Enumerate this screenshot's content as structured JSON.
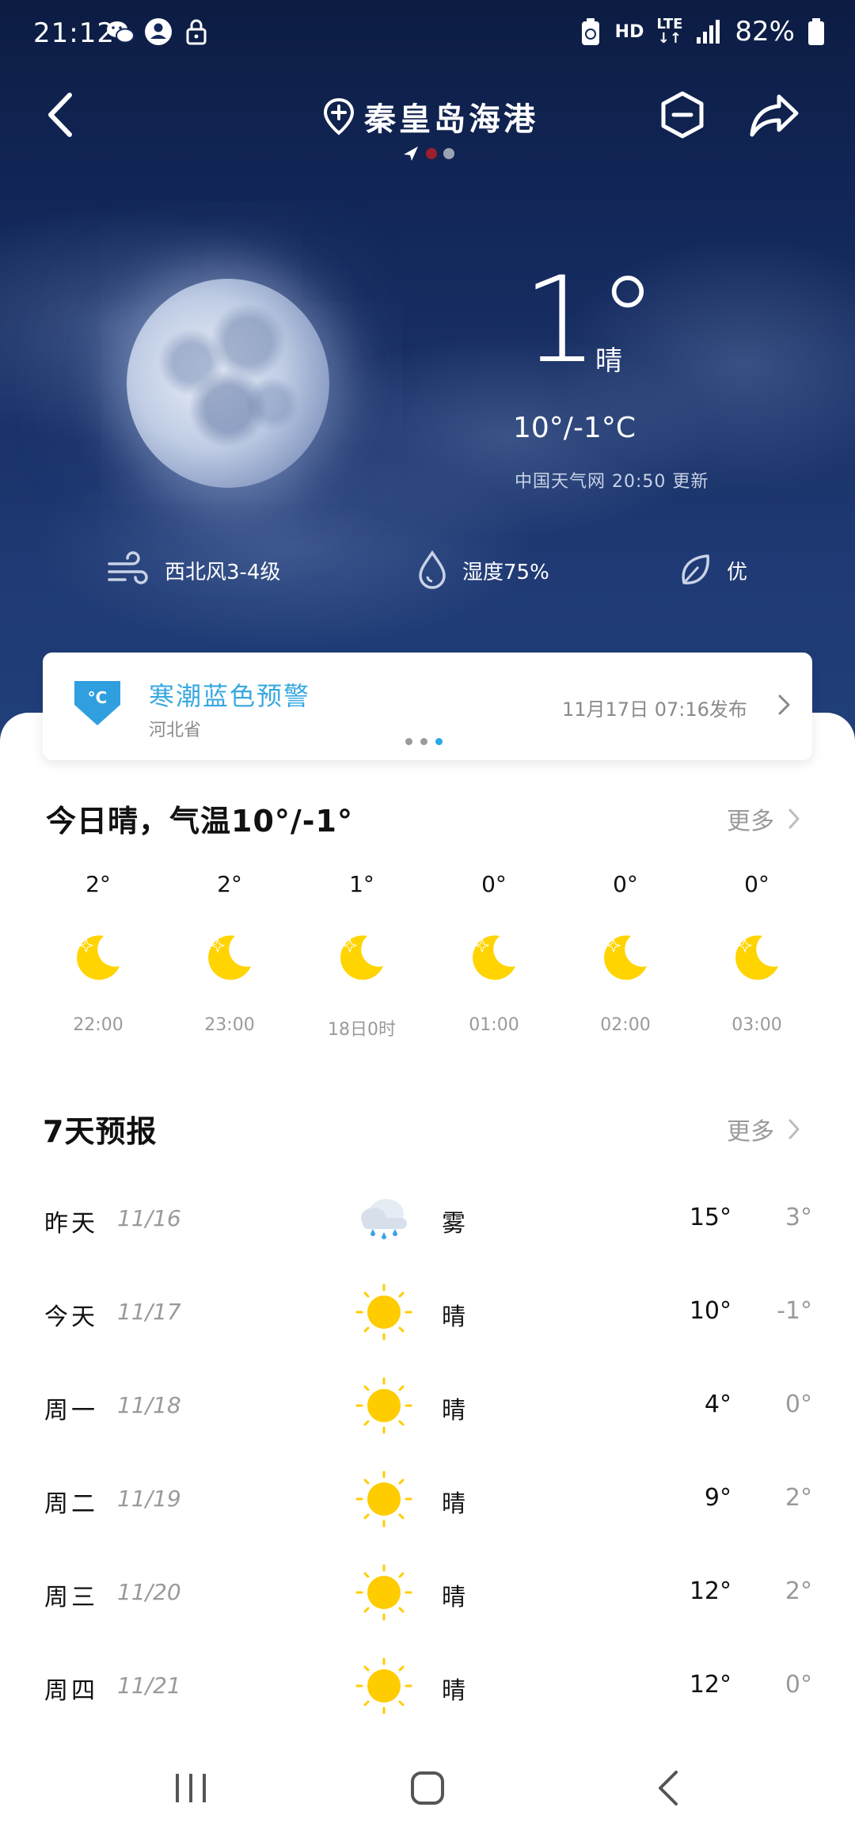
{
  "status_bar": {
    "time": "21:12",
    "network_hd": "HD",
    "network_lte": "LTE",
    "battery": "82%"
  },
  "header": {
    "city": "秦皇岛海港",
    "page_dots": [
      "location",
      "current",
      "other"
    ]
  },
  "current": {
    "temp": "1°",
    "condition": "晴",
    "range": "10°/-1°C",
    "source": "中国天气网 20:50 更新",
    "wind": "西北风3-4级",
    "humidity": "湿度75%",
    "air_quality": "优"
  },
  "alert": {
    "title": "寒潮蓝色预警",
    "region": "河北省",
    "published": "11月17日 07:16发布",
    "icon_text": "°C",
    "color": "#39a8e0"
  },
  "today": {
    "title": "今日晴，气温10°/-1°",
    "more": "更多",
    "hours": [
      {
        "temp": "2°",
        "time": "22:00",
        "icon": "moon-star-icon"
      },
      {
        "temp": "2°",
        "time": "23:00",
        "icon": "moon-star-icon"
      },
      {
        "temp": "1°",
        "time": "18日0时",
        "icon": "moon-star-icon"
      },
      {
        "temp": "0°",
        "time": "01:00",
        "icon": "moon-star-icon"
      },
      {
        "temp": "0°",
        "time": "02:00",
        "icon": "moon-star-icon"
      },
      {
        "temp": "0°",
        "time": "03:00",
        "icon": "moon-star-icon"
      }
    ]
  },
  "forecast": {
    "title": "7天预报",
    "more": "更多",
    "days": [
      {
        "day": "昨天",
        "date": "11/16",
        "icon": "fog-rain-icon",
        "cond": "雾",
        "high": "15°",
        "low": "3°"
      },
      {
        "day": "今天",
        "date": "11/17",
        "icon": "sun-icon",
        "cond": "晴",
        "high": "10°",
        "low": "-1°"
      },
      {
        "day": "周一",
        "date": "11/18",
        "icon": "sun-icon",
        "cond": "晴",
        "high": "4°",
        "low": "0°"
      },
      {
        "day": "周二",
        "date": "11/19",
        "icon": "sun-icon",
        "cond": "晴",
        "high": "9°",
        "low": "2°"
      },
      {
        "day": "周三",
        "date": "11/20",
        "icon": "sun-icon",
        "cond": "晴",
        "high": "12°",
        "low": "2°"
      },
      {
        "day": "周四",
        "date": "11/21",
        "icon": "sun-icon",
        "cond": "晴",
        "high": "12°",
        "low": "0°"
      }
    ]
  },
  "colors": {
    "sky_top": "#0c1c43",
    "sky_bottom": "#213f7a",
    "moon_icon": "#ffd400",
    "sun_icon": "#ffcc00",
    "page_dot_active": "#9b1f2e"
  }
}
